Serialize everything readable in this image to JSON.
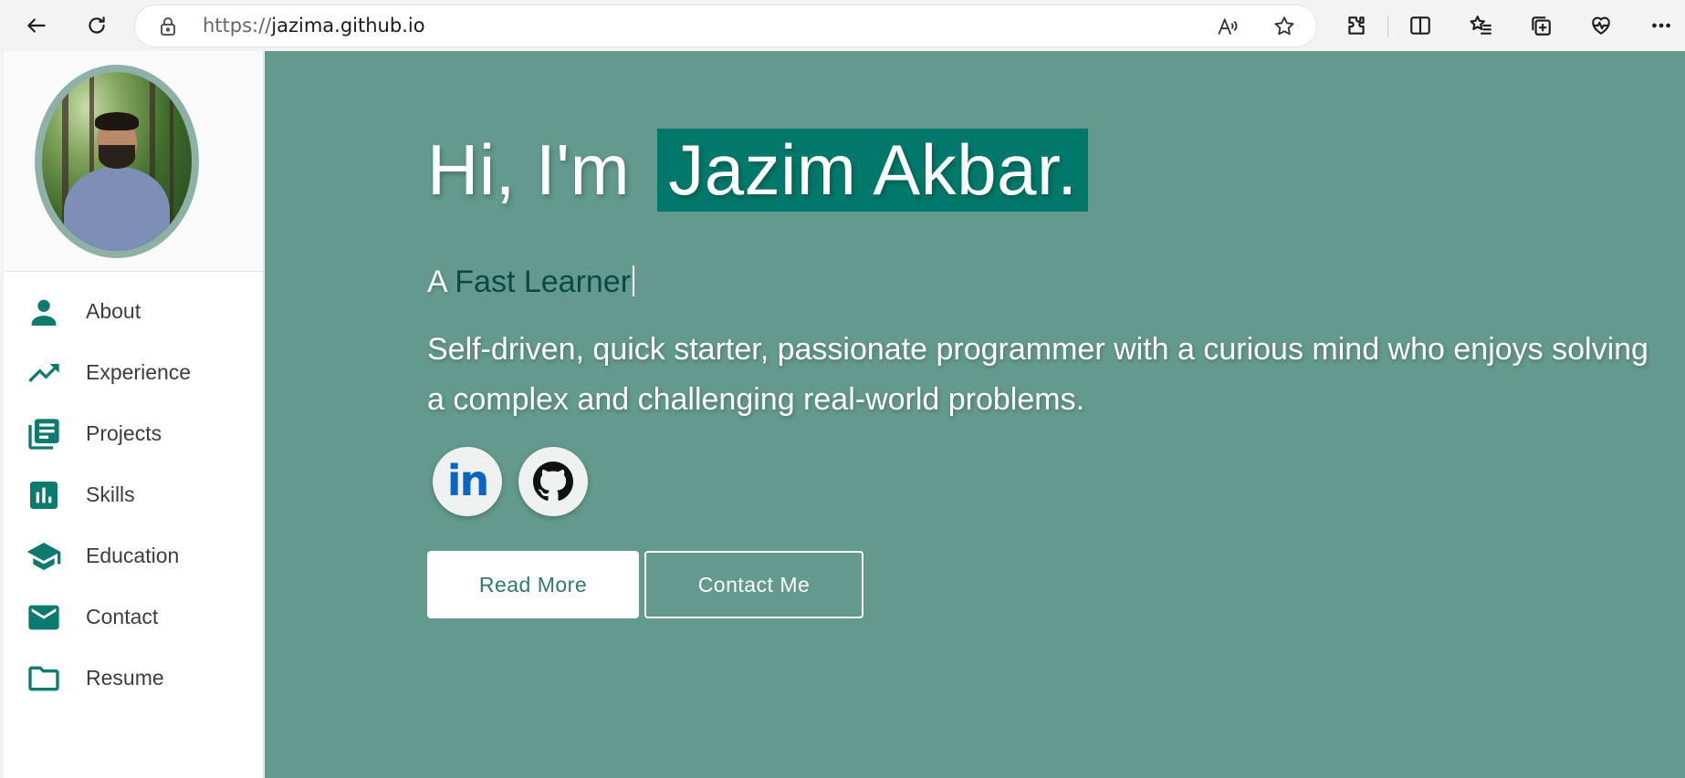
{
  "browser": {
    "url_protocol": "https://",
    "url_host": "jazima.github.io"
  },
  "sidebar": {
    "items": [
      {
        "label": "About",
        "icon": "person-icon"
      },
      {
        "label": "Experience",
        "icon": "trending-up-icon"
      },
      {
        "label": "Projects",
        "icon": "library-books-icon"
      },
      {
        "label": "Skills",
        "icon": "bar-chart-icon"
      },
      {
        "label": "Education",
        "icon": "school-icon"
      },
      {
        "label": "Contact",
        "icon": "mail-icon"
      },
      {
        "label": "Resume",
        "icon": "folder-icon"
      }
    ]
  },
  "hero": {
    "greeting_prefix": "Hi, I'm",
    "name": "Jazim Akbar.",
    "tagline_prefix": "A",
    "tagline_typed": "Fast Learner",
    "bio": "Self-driven, quick starter, passionate programmer with a curious mind who enjoys solving a complex and challenging real-world problems.",
    "social": {
      "linkedin_text": "in"
    },
    "buttons": {
      "read_more": "Read More",
      "contact_me": "Contact Me"
    }
  },
  "colors": {
    "accent": "#00796b",
    "hero_bg": "#639a8d",
    "icon": "#0d7a6f",
    "linkedin": "#0a66c2"
  }
}
